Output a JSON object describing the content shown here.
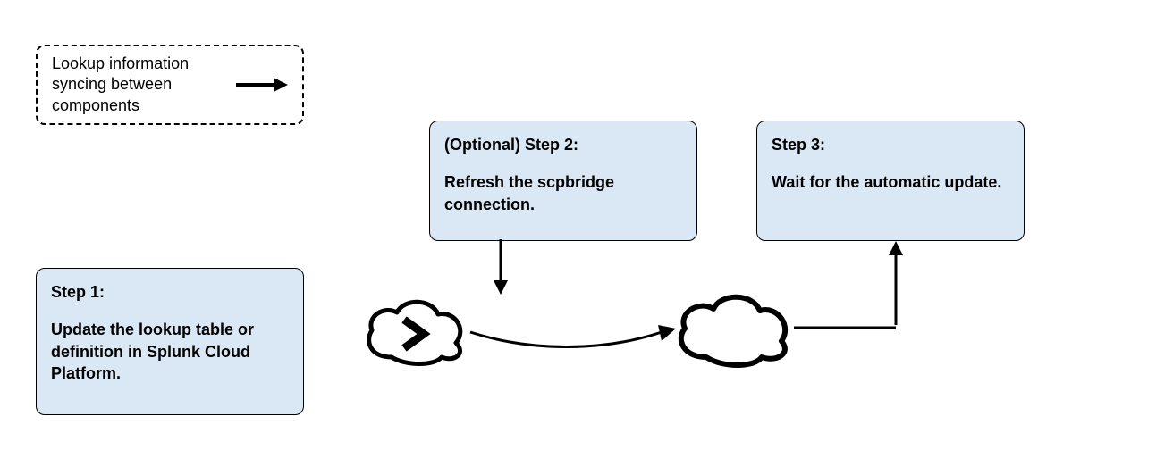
{
  "legend": {
    "text": "Lookup information syncing between components"
  },
  "steps": {
    "step1": {
      "title": "Step 1:",
      "body": "Update the lookup table or definition in Splunk Cloud Platform."
    },
    "step2": {
      "title": "(Optional) Step 2:",
      "body": "Refresh the scpbridge connection."
    },
    "step3": {
      "title": "Step 3:",
      "body": "Wait for the automatic update."
    }
  },
  "icons": {
    "cloudA": "cloud-chevron",
    "cloudB": "cloud"
  }
}
